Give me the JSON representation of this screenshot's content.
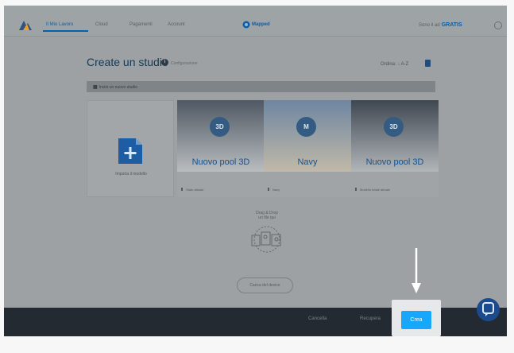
{
  "topnav": {
    "tabs": [
      "Il Mio Lavoro",
      "Cloud",
      "Pagamenti",
      "Account"
    ],
    "brand": "Mapped",
    "upgrade_text": "Sono il ad",
    "upgrade_brand": "GRATIS"
  },
  "header": {
    "title": "Create un studio",
    "config_text": "Configurazione",
    "sort_text": "Ordina: ↓ A-Z"
  },
  "filters": {
    "active_tab": "Inizio un nuovo studio"
  },
  "import_tile": {
    "label": "Importa il modello"
  },
  "cards": [
    {
      "title": "Nuovo pool 3D",
      "icon_text": "3D",
      "meta": "Stato attuale",
      "gradient_top": "#4f5863",
      "gradient_bottom": "#b9bdc0"
    },
    {
      "title": "Navy",
      "icon_text": "M",
      "meta": "Navy",
      "gradient_top": "#6e86a1",
      "gradient_bottom": "#c1b9a8"
    },
    {
      "title": "Nuovo pool 3D",
      "icon_text": "3D",
      "meta": "Modello totale attuale",
      "gradient_top": "#3f4751",
      "gradient_bottom": "#b1b6b9"
    }
  ],
  "drop": {
    "title": "Drag & Drop",
    "subtitle": "un file qui"
  },
  "browse_label": "Carica del device",
  "bottom": {
    "cancel": "Cancella",
    "next": "Recupera",
    "create": "Crea"
  },
  "colors": {
    "accent": "#17a7ff",
    "brand_blue": "#0a5ea8",
    "bottom_bar": "#232a31"
  }
}
